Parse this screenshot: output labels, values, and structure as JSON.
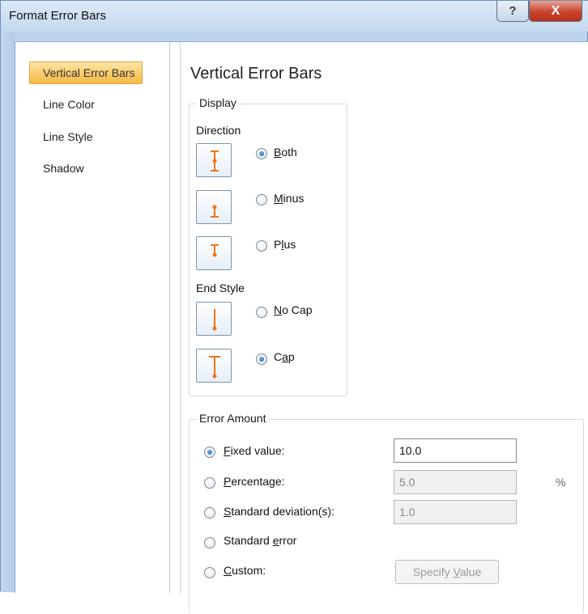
{
  "window": {
    "title": "Format Error Bars",
    "help_glyph": "?",
    "close_glyph": "X"
  },
  "nav": {
    "items": [
      {
        "label": "Vertical Error Bars",
        "active": true
      },
      {
        "label": "Line Color"
      },
      {
        "label": "Line Style"
      },
      {
        "label": "Shadow"
      }
    ]
  },
  "panel": {
    "title": "Vertical Error Bars",
    "display": {
      "label": "Display",
      "direction_label": "Direction",
      "direction_options": [
        {
          "label": "Both",
          "mnemonic": "B",
          "rest": "oth",
          "selected": true,
          "icon": "error-bar-both-icon"
        },
        {
          "label": "Minus",
          "mnemonic": "M",
          "rest": "inus",
          "selected": false,
          "icon": "error-bar-minus-icon"
        },
        {
          "label": "Plus",
          "pre": "P",
          "mnemonic": "l",
          "rest": "us",
          "selected": false,
          "icon": "error-bar-plus-icon"
        }
      ],
      "end_style_label": "End Style",
      "end_style_options": [
        {
          "label": "No Cap",
          "mnemonic": "N",
          "rest": "o Cap",
          "selected": false,
          "icon": "error-bar-no-cap-icon"
        },
        {
          "label": "Cap",
          "pre": "C",
          "mnemonic": "a",
          "rest": "p",
          "selected": true,
          "icon": "error-bar-cap-icon"
        }
      ]
    },
    "error_amount": {
      "label": "Error Amount",
      "fixed_value": {
        "mnemonic": "F",
        "rest": "ixed value:",
        "value": "10.0",
        "selected": true
      },
      "percentage": {
        "mnemonic": "P",
        "rest": "ercentage:",
        "value": "5.0",
        "unit": "%",
        "selected": false
      },
      "std_dev": {
        "mnemonic": "S",
        "rest": "tandard deviation(s):",
        "value": "1.0",
        "selected": false
      },
      "std_error": {
        "pre": "Standard ",
        "mnemonic": "e",
        "rest": "rror",
        "selected": false
      },
      "custom": {
        "mnemonic": "C",
        "rest": "ustom:",
        "selected": false
      },
      "specify_button": {
        "pre": "Specify ",
        "mnemonic": "V",
        "rest": "alue"
      }
    }
  },
  "colors": {
    "accent_orange": "#e8771e",
    "nav_active": "#f8c866",
    "radio_selected": "#1f5fb0"
  }
}
